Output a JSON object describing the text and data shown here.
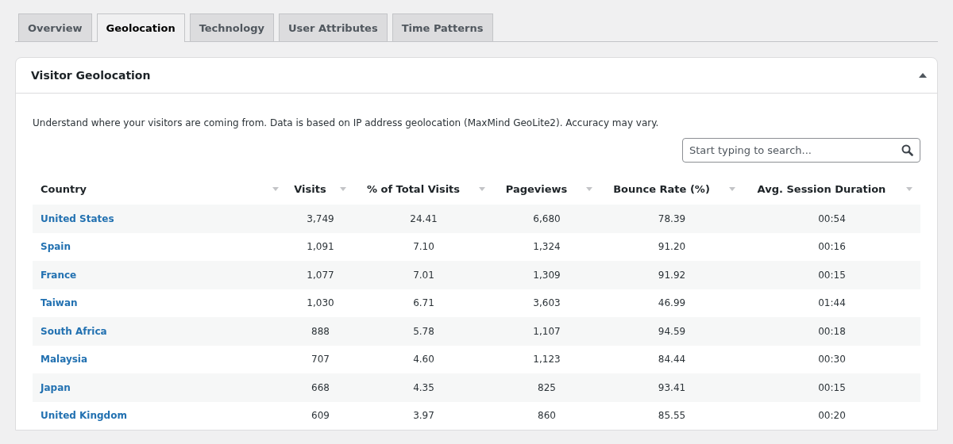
{
  "tabs": [
    {
      "label": "Overview",
      "selected": false
    },
    {
      "label": "Geolocation",
      "selected": true
    },
    {
      "label": "Technology",
      "selected": false
    },
    {
      "label": "User Attributes",
      "selected": false
    },
    {
      "label": "Time Patterns",
      "selected": false
    }
  ],
  "panel": {
    "title": "Visitor Geolocation",
    "expanded": true,
    "description": "Understand where your visitors are coming from. Data is based on IP address geolocation (MaxMind GeoLite2). Accuracy may vary.",
    "search": {
      "placeholder": "Start typing to search..."
    },
    "table": {
      "columns": [
        "Country",
        "Visits",
        "% of Total Visits",
        "Pageviews",
        "Bounce Rate (%)",
        "Avg. Session Duration"
      ],
      "rows": [
        [
          "United States",
          "3,749",
          "24.41",
          "6,680",
          "78.39",
          "00:54"
        ],
        [
          "Spain",
          "1,091",
          "7.10",
          "1,324",
          "91.20",
          "00:16"
        ],
        [
          "France",
          "1,077",
          "7.01",
          "1,309",
          "91.92",
          "00:15"
        ],
        [
          "Taiwan",
          "1,030",
          "6.71",
          "3,603",
          "46.99",
          "01:44"
        ],
        [
          "South Africa",
          "888",
          "5.78",
          "1,107",
          "94.59",
          "00:18"
        ],
        [
          "Malaysia",
          "707",
          "4.60",
          "1,123",
          "84.44",
          "00:30"
        ],
        [
          "Japan",
          "668",
          "4.35",
          "825",
          "93.41",
          "00:15"
        ],
        [
          "United Kingdom",
          "609",
          "3.97",
          "860",
          "85.55",
          "00:20"
        ]
      ]
    }
  }
}
